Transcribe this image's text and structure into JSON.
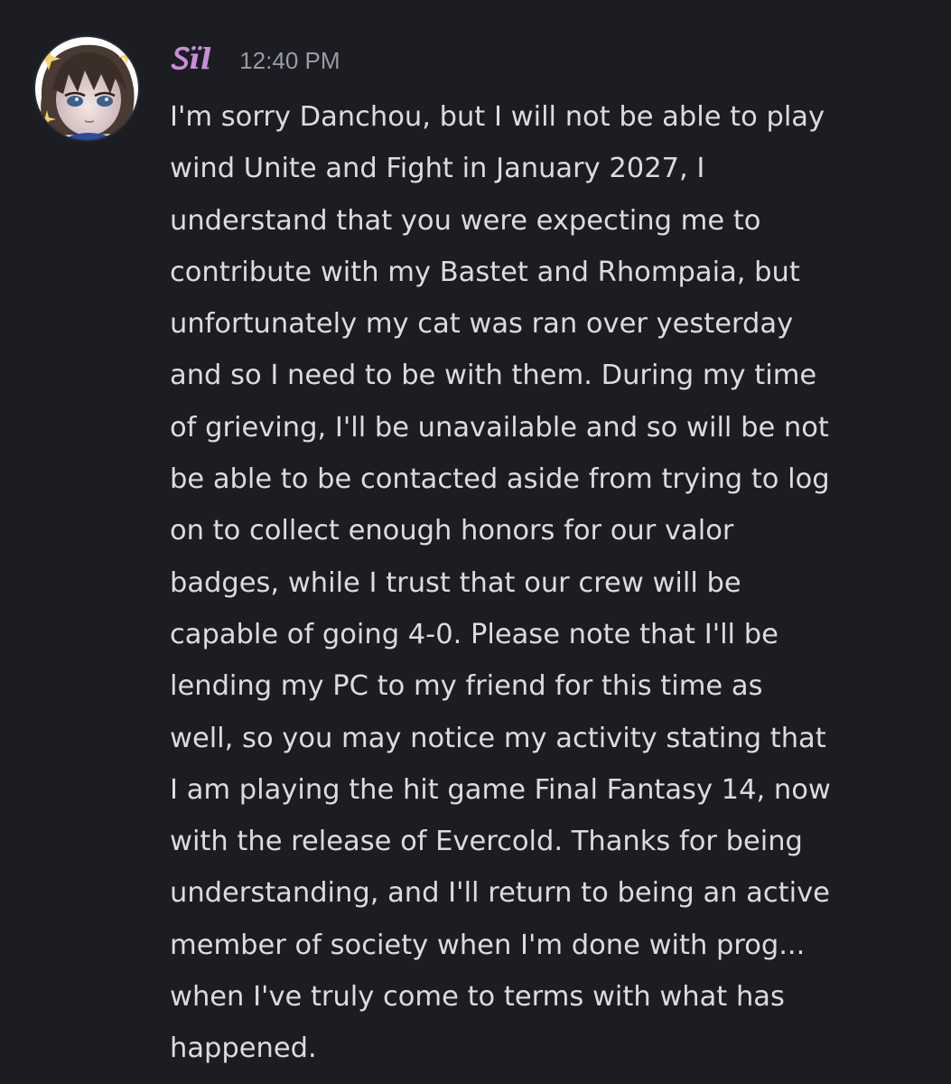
{
  "message": {
    "author": {
      "name": "Ꮪïl",
      "avatar_icon": "anime-character-avatar-icon",
      "name_color": "#c98ed6"
    },
    "timestamp": "12:40 PM",
    "text": "I'm sorry Danchou, but I will not be able to play\nwind Unite and Fight in January 2027, I\nunderstand that you were expecting me to\ncontribute with my Bastet and Rhompaia, but\nunfortunately my cat was ran over yesterday\nand so I need to be with them. During my time\nof grieving, I'll be unavailable and so will be not\nbe able to be contacted aside from trying to log\non to collect enough honors for our valor\nbadges, while I trust that our crew will be\ncapable of going 4-0. Please note that I'll be\nlending my PC to my friend for this time as\nwell, so you may notice my activity stating that\nI am playing the hit game Final Fantasy 14, now\nwith the release of Evercold. Thanks for being\nunderstanding, and I'll return to being an active\nmember of society when I'm done with prog...\nwhen I've truly come to terms with what has\nhappened."
  },
  "colors": {
    "background": "#1c1d23",
    "text": "#dbdce1",
    "timestamp": "#9a9ba3"
  }
}
